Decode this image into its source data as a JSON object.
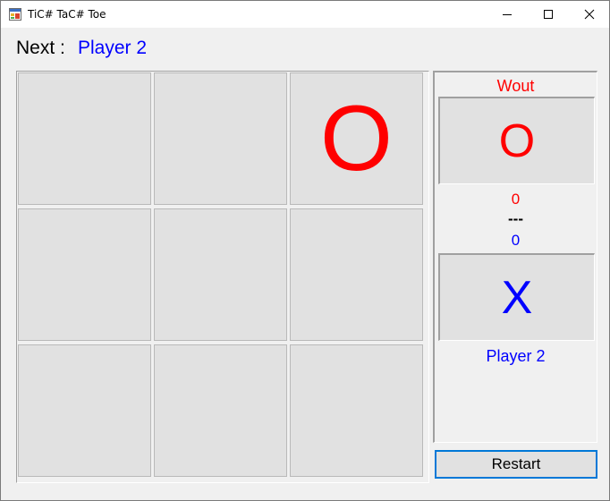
{
  "window": {
    "title": "TiC# TaC# Toe",
    "icon": "app-window-icon",
    "controls": [
      "minimize-icon",
      "maximize-icon",
      "close-icon"
    ]
  },
  "status": {
    "next_label": "Next :",
    "next_player": "Player 2"
  },
  "board": {
    "cells": [
      "",
      "",
      "O",
      "",
      "",
      "",
      "",
      "",
      ""
    ]
  },
  "scoreboard": {
    "player1": {
      "name": "Wout",
      "mark": "O",
      "score": "0",
      "color": "#ff0000"
    },
    "separator": "---",
    "player2": {
      "name": "Player 2",
      "mark": "X",
      "score": "0",
      "color": "#0000ff"
    }
  },
  "actions": {
    "restart_label": "Restart"
  },
  "colors": {
    "accent": "#0078d7",
    "player1": "#ff0000",
    "player2": "#0000ff",
    "cell_background": "#e1e1e1",
    "window_background": "#f0f0f0"
  }
}
